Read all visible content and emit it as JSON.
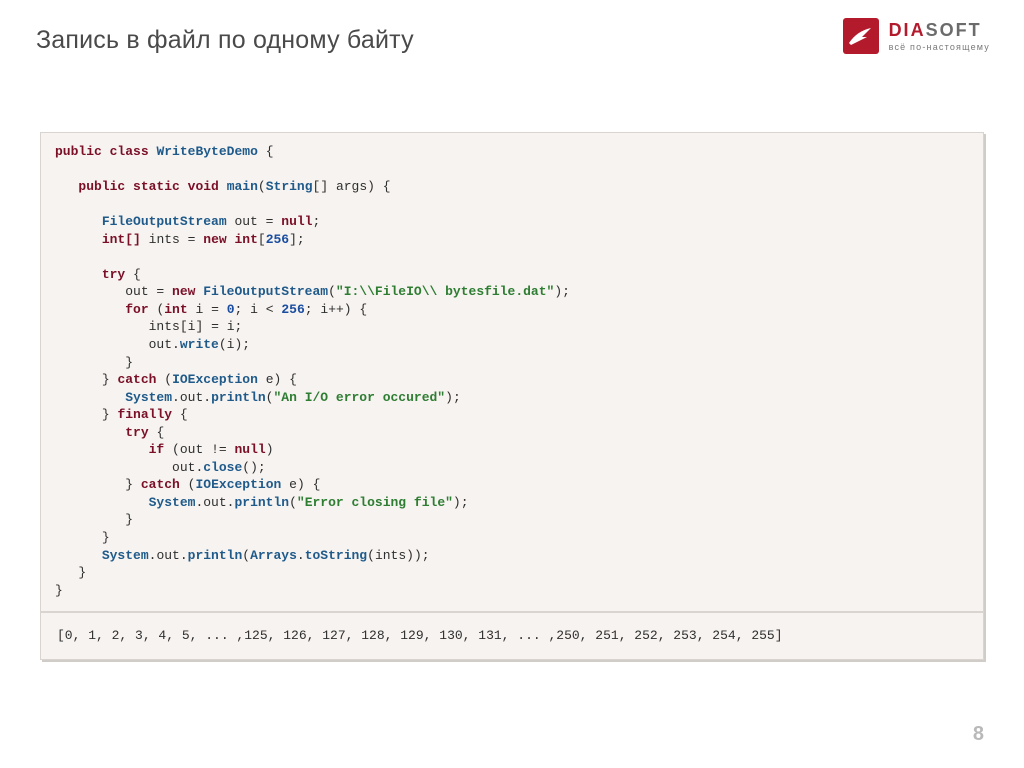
{
  "header": {
    "title": "Запись в файл по одному байту",
    "logo": {
      "brand_main": "DIA",
      "brand_rest": "SOFT",
      "tagline": "всё по-настоящему"
    }
  },
  "code": {
    "kw": {
      "public": "public",
      "class": "class",
      "static": "static",
      "void": "void",
      "null": "null",
      "int": "int",
      "intArr": "int[]",
      "new": "new",
      "try": "try",
      "for": "for",
      "catch": "catch",
      "finally": "finally",
      "if": "if"
    },
    "id": {
      "ClassName": "WriteByteDemo",
      "main": "main",
      "String": "String",
      "args": "args",
      "FileOutputStream": "FileOutputStream",
      "out": "out",
      "ints": "ints",
      "IOException": "IOException",
      "e": "e",
      "System": "System",
      "println": "println",
      "i": "i",
      "write": "write",
      "close": "close",
      "Arrays": "Arrays",
      "toString": "toString"
    },
    "num": {
      "n256": "256",
      "n0": "0"
    },
    "str": {
      "path": "\"I:\\\\FileIO\\\\ bytesfile.dat\"",
      "err1": "\"An I/O error occured\"",
      "err2": "\"Error closing file\""
    },
    "punct": {
      "lbrace": "{",
      "rbrace": "}",
      "lparen": "(",
      "rparen": ")",
      "lbracket": "[",
      "rbracket": "]",
      "semi": ";",
      "comma": ", ",
      "dot": ".",
      "eq": " = ",
      "lt": " < ",
      "inc": "++",
      "neq": " != ",
      "args_brackets": "[] "
    }
  },
  "output": "[0, 1, 2, 3, 4, 5, ... ,125, 126, 127, 128, 129, 130, 131, ... ,250, 251, 252, 253, 254, 255]",
  "pageNumber": "8"
}
